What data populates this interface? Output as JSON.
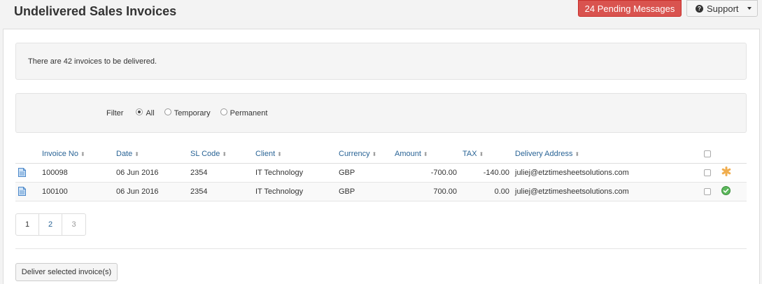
{
  "header": {
    "title": "Undelivered Sales Invoices",
    "pending_label": "24 Pending Messages",
    "support_label": "Support"
  },
  "info": {
    "message": "There are 42 invoices to be delivered."
  },
  "filter": {
    "label": "Filter",
    "options": [
      "All",
      "Temporary",
      "Permanent"
    ],
    "selected": "All"
  },
  "table": {
    "columns": [
      "Invoice No",
      "Date",
      "SL Code",
      "Client",
      "Currency",
      "Amount",
      "TAX",
      "Delivery Address"
    ],
    "rows": [
      {
        "invoice_no": "100098",
        "date": "06 Jun 2016",
        "sl_code": "2354",
        "client": "IT Technology",
        "currency": "GBP",
        "amount": "-700.00",
        "tax": "-140.00",
        "address": "juliej@etztimesheetsolutions.com",
        "status_icon": "asterisk-icon"
      },
      {
        "invoice_no": "100100",
        "date": "06 Jun 2016",
        "sl_code": "2354",
        "client": "IT Technology",
        "currency": "GBP",
        "amount": "700.00",
        "tax": "0.00",
        "address": "juliej@etztimesheetsolutions.com",
        "status_icon": "check-circle-icon"
      }
    ]
  },
  "pagination": {
    "pages": [
      "1",
      "2",
      "3"
    ]
  },
  "actions": {
    "deliver_label": "Deliver selected invoice(s)"
  },
  "colors": {
    "danger": "#d9534f",
    "link": "#2a6496",
    "warning_icon": "#f0ad4e",
    "success_icon": "#5cb85c"
  }
}
